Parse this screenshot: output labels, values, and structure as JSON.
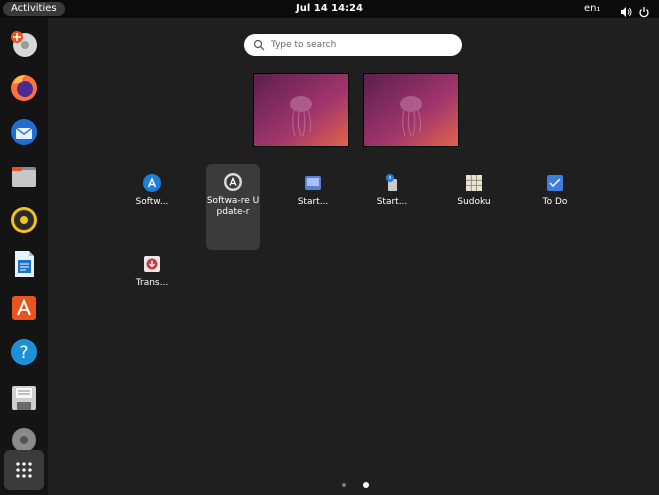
{
  "topbar": {
    "activities_label": "Activities",
    "clock": "Jul 14  14:24",
    "language": "en₁"
  },
  "search": {
    "placeholder": "Type to search"
  },
  "dock": {
    "items": [
      "disk-icon",
      "firefox-icon",
      "thunderbird-icon",
      "files-icon",
      "rhythmbox-icon",
      "writer-icon",
      "app-center-icon",
      "help-icon",
      "save-icon",
      "disc-icon",
      "show-apps-icon"
    ]
  },
  "apps": [
    {
      "label": "Softw...",
      "icon": "software-icon"
    },
    {
      "label": "Softwa-re Update-r",
      "icon": "software-updater-icon"
    },
    {
      "label": "Start...",
      "icon": "startup-disk-icon"
    },
    {
      "label": "Start...",
      "icon": "startup-apps-icon"
    },
    {
      "label": "Sudoku",
      "icon": "sudoku-icon"
    },
    {
      "label": "To Do",
      "icon": "todo-icon"
    },
    {
      "label": "Trans...",
      "icon": "transmission-icon"
    }
  ],
  "colors": {
    "accent": "#e95420",
    "bg": "#1f1f1f"
  }
}
